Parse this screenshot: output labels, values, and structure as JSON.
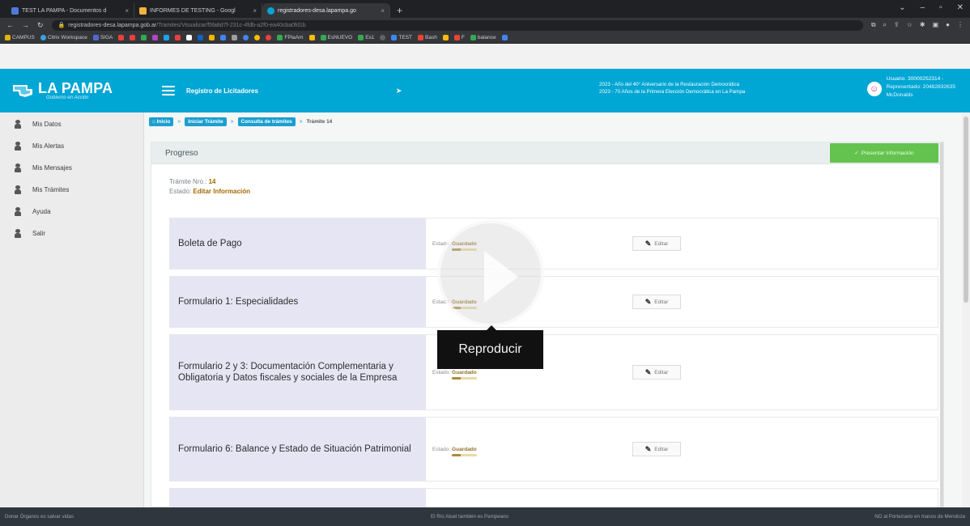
{
  "browser": {
    "tabs": [
      {
        "title": "TEST LA PAMPA - Documentos d",
        "color": "#4f7bd8",
        "active": false
      },
      {
        "title": "INFORMES DE TESTING - Googl",
        "color": "#f2b23c",
        "active": false
      },
      {
        "title": "registradores-desa.lapampa.go",
        "color": "#00a6d4",
        "active": true
      }
    ],
    "url_host": "registradores-desa.lapampa.gob.ar",
    "url_path": "/Tramites/Visualizar/f5fa8d7f-231c-4fdb-a2f0-ea40cba0fd1b",
    "bookmarks": [
      "CAMPUS",
      "Citrix Workspace",
      "SIGA",
      "FPlaAm",
      "EsNUEVO",
      "Es1",
      "TEST",
      "Bash",
      "F",
      "balance"
    ]
  },
  "header": {
    "brand_name": "LA PAMPA",
    "brand_sub": "Gobierno en Acción",
    "app_title": "Registro de Licitadores",
    "motto_1": "2023 - Año del 40° Aniversario de la Restauración Democrática",
    "motto_2": "2023 - 70 Años de la Primera Elección Democrática en La Pampa",
    "user_line_1": "Usuario: 30000252314 -",
    "user_line_2": "Representado: 20482832635",
    "user_line_3": "McDonalds"
  },
  "sidebar": {
    "items": [
      "Mis Datos",
      "Mis Alertas",
      "Mis Mensajes",
      "Mis Trámites",
      "Ayuda",
      "Salir"
    ]
  },
  "breadcrumb": {
    "home": "Inicio",
    "step_1": "Iniciar Trámite",
    "step_2": "Consulta de trámites",
    "current": "Trámite 14"
  },
  "card": {
    "title": "Progreso",
    "present_button": "Presentar Información",
    "tramite_label": "Trámite Nro.: ",
    "tramite_number": "14",
    "estado_label": "Estado: ",
    "estado_value": "Editar Información"
  },
  "forms": [
    {
      "title": "Boleta de Pago",
      "state_label": "Estado: ",
      "state": "Guardado",
      "progress": 0.35
    },
    {
      "title": "Formulario 1: Especialidades",
      "state_label": "Estado: ",
      "state": "Guardado",
      "progress": 0.35
    },
    {
      "title": "Formulario 2 y 3: Documentación Complementaria y Obligatoria y Datos fiscales y sociales de la Empresa",
      "state_label": "Estado: ",
      "state": "Guardado",
      "progress": 0.35
    },
    {
      "title": "Formulario 6: Balance y Estado de Situación Patrimonial",
      "state_label": "Estado: ",
      "state": "Guardado",
      "progress": 0.35
    }
  ],
  "edit_label": "Editar",
  "video": {
    "tooltip": "Reproducir"
  },
  "footer": {
    "left": "Donar Órganos es salvar vidas",
    "center": "El Río Atuel también es Pampeano",
    "right": "NO al Portezuelo en manos de Mendoza"
  }
}
